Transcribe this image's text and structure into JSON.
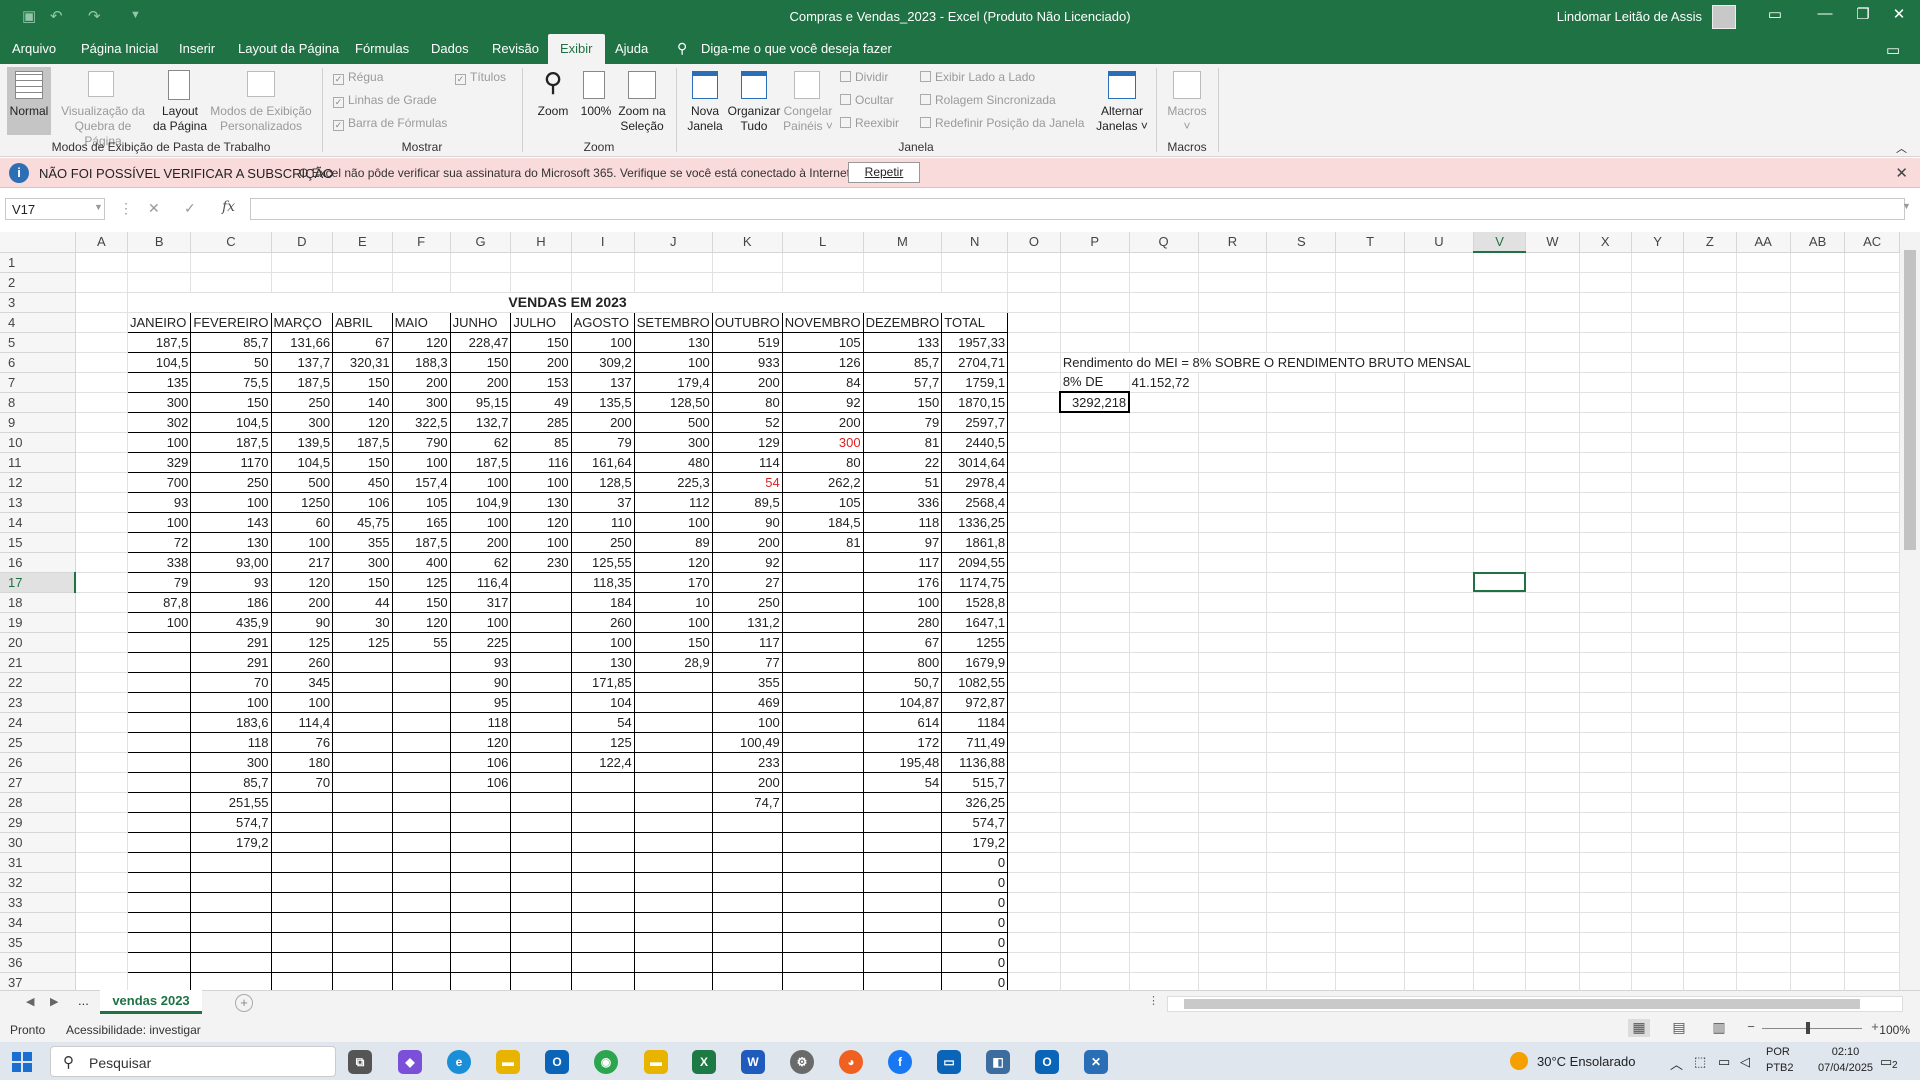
{
  "window": {
    "title": "Compras e Vendas_2023  -  Excel (Produto Não Licenciado)",
    "user": "Lindomar Leitão de Assis",
    "minimize_glyph": "—",
    "restore_glyph": "❐",
    "close_glyph": "✕",
    "ribbon_display_glyph": "▭",
    "quick_access": [
      "save-icon",
      "undo-icon",
      "redo-icon",
      "customize-icon"
    ]
  },
  "tabs": [
    "Arquivo",
    "Página Inicial",
    "Inserir",
    "Layout da Página",
    "Fórmulas",
    "Dados",
    "Revisão",
    "Exibir",
    "Ajuda"
  ],
  "active_tab": "Exibir",
  "tell_me": "Diga-me o que você deseja fazer",
  "ribbon": {
    "normal": "Normal",
    "page_break": [
      "Visualização da",
      "Quebra de Página"
    ],
    "page_layout": [
      "Layout",
      "da Página"
    ],
    "custom_views": [
      "Modos de Exibição",
      "Personalizados"
    ],
    "group_workbook_views": "Modos de Exibição de Pasta de Trabalho",
    "ruler": "Régua",
    "titles": "Títulos",
    "gridlines": "Linhas de Grade",
    "formula_bar": "Barra de Fórmulas",
    "group_show": "Mostrar",
    "zoom": "Zoom",
    "zoom100": "100%",
    "zoom_sel": [
      "Zoom na",
      "Seleção"
    ],
    "group_zoom": "Zoom",
    "new_window": [
      "Nova",
      "Janela"
    ],
    "arrange": [
      "Organizar",
      "Tudo"
    ],
    "freeze": [
      "Congelar",
      "Painéis ˅"
    ],
    "split": "Dividir",
    "hide": "Ocultar",
    "unhide": "Reexibir",
    "side_by_side": "Exibir Lado a Lado",
    "sync_scroll": "Rolagem Sincronizada",
    "reset_pos": "Redefinir Posição da Janela",
    "switch": [
      "Alternar",
      "Janelas ˅"
    ],
    "group_window": "Janela",
    "macros": [
      "Macros",
      "˅"
    ],
    "group_macros": "Macros"
  },
  "message": {
    "title": "NÃO FOI POSSÍVEL VERIFICAR A SUBSCRIÇÃO",
    "text": "O Excel não pôde verificar sua assinatura do Microsoft 365. Verifique se você está conectado à Internet.",
    "button": "Repetir",
    "info_glyph": "i",
    "close_glyph": "✕"
  },
  "formula_bar": {
    "name_box": "V17",
    "cancel": "✕",
    "enter": "✓",
    "fx": "fx",
    "value": ""
  },
  "columns": [
    "A",
    "B",
    "C",
    "D",
    "E",
    "F",
    "G",
    "H",
    "I",
    "J",
    "K",
    "L",
    "M",
    "N",
    "O",
    "P",
    "Q",
    "R",
    "S",
    "T",
    "U",
    "V",
    "W",
    "X",
    "Y",
    "Z",
    "AA",
    "AB",
    "AC"
  ],
  "selected": {
    "col": "V",
    "row": 17
  },
  "sheet": {
    "title": "VENDAS EM 2023",
    "headers": [
      "JANEIRO",
      "FEVEREIRO",
      "MARÇO",
      "ABRIL",
      "MAIO",
      "JUNHO",
      "JULHO",
      "AGOSTO",
      "SETEMBRO",
      "OUTUBRO",
      "NOVEMBRO",
      "DEZEMBRO",
      "TOTAL"
    ],
    "rows": [
      [
        "187,5",
        "85,7",
        "131,66",
        "67",
        "120",
        "228,47",
        "150",
        "100",
        "130",
        "519",
        "105",
        "133",
        "1957,33"
      ],
      [
        "104,5",
        "50",
        "137,7",
        "320,31",
        "188,3",
        "150",
        "200",
        "309,2",
        "100",
        "933",
        "126",
        "85,7",
        "2704,71"
      ],
      [
        "135",
        "75,5",
        "187,5",
        "150",
        "200",
        "200",
        "153",
        "137",
        "179,4",
        "200",
        "84",
        "57,7",
        "1759,1"
      ],
      [
        "300",
        "150",
        "250",
        "140",
        "300",
        "95,15",
        "49",
        "135,5",
        "128,50",
        "80",
        "92",
        "150",
        "1870,15"
      ],
      [
        "302",
        "104,5",
        "300",
        "120",
        "322,5",
        "132,7",
        "285",
        "200",
        "500",
        "52",
        "200",
        "79",
        "2597,7"
      ],
      [
        "100",
        "187,5",
        "139,5",
        "187,5",
        "790",
        "62",
        "85",
        "79",
        "300",
        "129",
        "300",
        "81",
        "2440,5"
      ],
      [
        "329",
        "1170",
        "104,5",
        "150",
        "100",
        "187,5",
        "116",
        "161,64",
        "480",
        "114",
        "80",
        "22",
        "3014,64"
      ],
      [
        "700",
        "250",
        "500",
        "450",
        "157,4",
        "100",
        "100",
        "128,5",
        "225,3",
        "54",
        "262,2",
        "51",
        "2978,4"
      ],
      [
        "93",
        "100",
        "1250",
        "106",
        "105",
        "104,9",
        "130",
        "37",
        "112",
        "89,5",
        "105",
        "336",
        "2568,4"
      ],
      [
        "100",
        "143",
        "60",
        "45,75",
        "165",
        "100",
        "120",
        "110",
        "100",
        "90",
        "184,5",
        "118",
        "1336,25"
      ],
      [
        "72",
        "130",
        "100",
        "355",
        "187,5",
        "200",
        "100",
        "250",
        "89",
        "200",
        "81",
        "97",
        "1861,8"
      ],
      [
        "338",
        "93,00",
        "217",
        "300",
        "400",
        "62",
        "230",
        "125,55",
        "120",
        "92",
        "",
        "117",
        "2094,55"
      ],
      [
        "79",
        "93",
        "120",
        "150",
        "125",
        "116,4",
        "",
        "118,35",
        "170",
        "27",
        "",
        "176",
        "1174,75"
      ],
      [
        "87,8",
        "186",
        "200",
        "44",
        "150",
        "317",
        "",
        "184",
        "10",
        "250",
        "",
        "100",
        "1528,8"
      ],
      [
        "100",
        "435,9",
        "90",
        "30",
        "120",
        "100",
        "",
        "260",
        "100",
        "131,2",
        "",
        "280",
        "1647,1"
      ],
      [
        "",
        "291",
        "125",
        "125",
        "55",
        "225",
        "",
        "100",
        "150",
        "117",
        "",
        "67",
        "1255"
      ],
      [
        "",
        "291",
        "260",
        "",
        "",
        "93",
        "",
        "130",
        "28,9",
        "77",
        "",
        "800",
        "1679,9"
      ],
      [
        "",
        "70",
        "345",
        "",
        "",
        "90",
        "",
        "171,85",
        "",
        "355",
        "",
        "50,7",
        "1082,55"
      ],
      [
        "",
        "100",
        "100",
        "",
        "",
        "95",
        "",
        "104",
        "",
        "469",
        "",
        "104,87",
        "972,87"
      ],
      [
        "",
        "183,6",
        "114,4",
        "",
        "",
        "118",
        "",
        "54",
        "",
        "100",
        "",
        "614",
        "1184"
      ],
      [
        "",
        "118",
        "76",
        "",
        "",
        "120",
        "",
        "125",
        "",
        "100,49",
        "",
        "172",
        "711,49"
      ],
      [
        "",
        "300",
        "180",
        "",
        "",
        "106",
        "",
        "122,4",
        "",
        "233",
        "",
        "195,48",
        "1136,88"
      ],
      [
        "",
        "85,7",
        "70",
        "",
        "",
        "106",
        "",
        "",
        "",
        "200",
        "",
        "54",
        "515,7"
      ],
      [
        "",
        "251,55",
        "",
        "",
        "",
        "",
        "",
        "",
        "",
        "74,7",
        "",
        "",
        "326,25"
      ],
      [
        "",
        "574,7",
        "",
        "",
        "",
        "",
        "",
        "",
        "",
        "",
        "",
        "",
        "574,7"
      ],
      [
        "",
        "179,2",
        "",
        "",
        "",
        "",
        "",
        "",
        "",
        "",
        "",
        "",
        "179,2"
      ],
      [
        "",
        "",
        "",
        "",
        "",
        "",
        "",
        "",
        "",
        "",
        "",
        "",
        "0"
      ],
      [
        "",
        "",
        "",
        "",
        "",
        "",
        "",
        "",
        "",
        "",
        "",
        "",
        "0"
      ],
      [
        "",
        "",
        "",
        "",
        "",
        "",
        "",
        "",
        "",
        "",
        "",
        "",
        "0"
      ],
      [
        "",
        "",
        "",
        "",
        "",
        "",
        "",
        "",
        "",
        "",
        "",
        "",
        "0"
      ],
      [
        "",
        "",
        "",
        "",
        "",
        "",
        "",
        "",
        "",
        "",
        "",
        "",
        "0"
      ],
      [
        "",
        "",
        "",
        "",
        "",
        "",
        "",
        "",
        "",
        "",
        "",
        "",
        "0"
      ],
      [
        "",
        "",
        "",
        "",
        "",
        "",
        "",
        "",
        "",
        "",
        "",
        "",
        "0"
      ]
    ],
    "red_cells": [
      [
        10,
        "L"
      ],
      [
        12,
        "K"
      ]
    ],
    "mei_note": "Rendimento do MEI = 8% SOBRE O RENDIMENTO BRUTO MENSAL",
    "pct_label": "8% DE",
    "pct_base": "41.152,72",
    "pct_result": "3292,218"
  },
  "sheet_tabs": {
    "ellipsis": "...",
    "active": "vendas  2023",
    "add": "+"
  },
  "status": {
    "ready": "Pronto",
    "accessibility": "Acessibilidade: investigar",
    "zoom": "100%"
  },
  "taskbar": {
    "search_placeholder": "Pesquisar",
    "weather": "30°C  Ensolarado",
    "lang": [
      "POR",
      "PTB2"
    ],
    "time": "02:10",
    "date": "07/04/2025",
    "notif": "2"
  }
}
